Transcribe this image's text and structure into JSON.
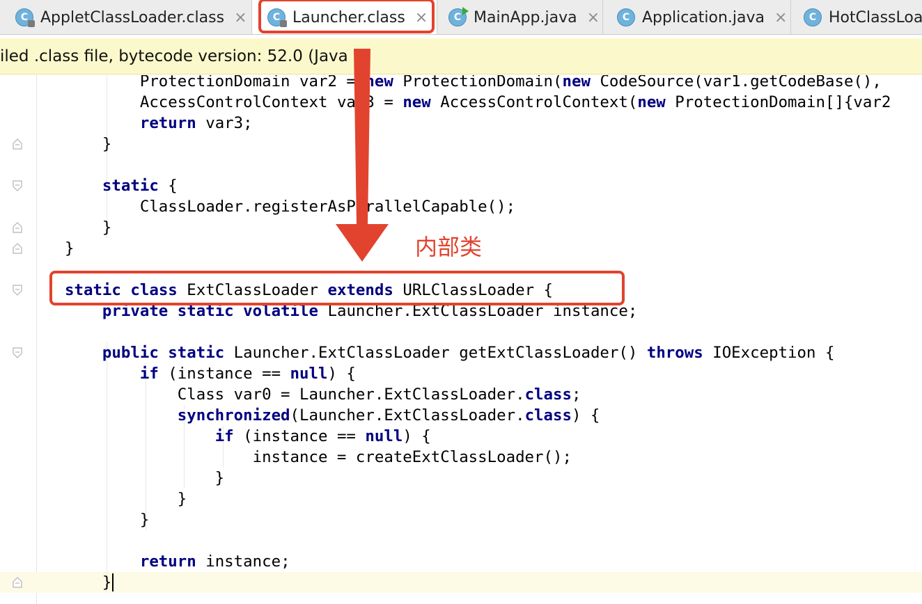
{
  "tabs": [
    {
      "label": "AppletClassLoader.class",
      "icon": "class-icon",
      "locked": true,
      "active": false
    },
    {
      "label": "Launcher.class",
      "icon": "class-icon",
      "locked": true,
      "active": true
    },
    {
      "label": "MainApp.java",
      "icon": "runnable-class-icon",
      "locked": false,
      "active": false
    },
    {
      "label": "Application.java",
      "icon": "class-icon",
      "locked": false,
      "active": false
    },
    {
      "label": "HotClassLoa",
      "icon": "class-icon",
      "locked": false,
      "active": false
    }
  ],
  "tab_icon_letter": "C",
  "tab_close_glyph": "×",
  "banner": {
    "text": "iled .class file, bytecode version: 52.0 (Java 8)"
  },
  "code_lines": [
    "        ProtectionDomain var2 = new ProtectionDomain(new CodeSource(var1.getCodeBase(),",
    "        AccessControlContext var3 = new AccessControlContext(new ProtectionDomain[]{var2",
    "        return var3;",
    "    }",
    "",
    "    static {",
    "        ClassLoader.registerAsParallelCapable();",
    "    }",
    "}",
    "",
    "static class ExtClassLoader extends URLClassLoader {",
    "    private static volatile Launcher.ExtClassLoader instance;",
    "",
    "    public static Launcher.ExtClassLoader getExtClassLoader() throws IOException {",
    "        if (instance == null) {",
    "            Class var0 = Launcher.ExtClassLoader.class;",
    "            synchronized(Launcher.ExtClassLoader.class) {",
    "                if (instance == null) {",
    "                    instance = createExtClassLoader();",
    "                }",
    "            }",
    "        }",
    "",
    "        return instance;",
    "    }"
  ],
  "keywords": [
    "new",
    "return",
    "static",
    "class",
    "extends",
    "private",
    "volatile",
    "public",
    "throws",
    "if",
    "null",
    "synchronized"
  ],
  "annotation": {
    "label": "内部类"
  },
  "colors": {
    "keyword": "#000080",
    "annotation": "#e2432e",
    "banner": "#fbf9cc",
    "tab_icon": "#6fb2dc"
  }
}
